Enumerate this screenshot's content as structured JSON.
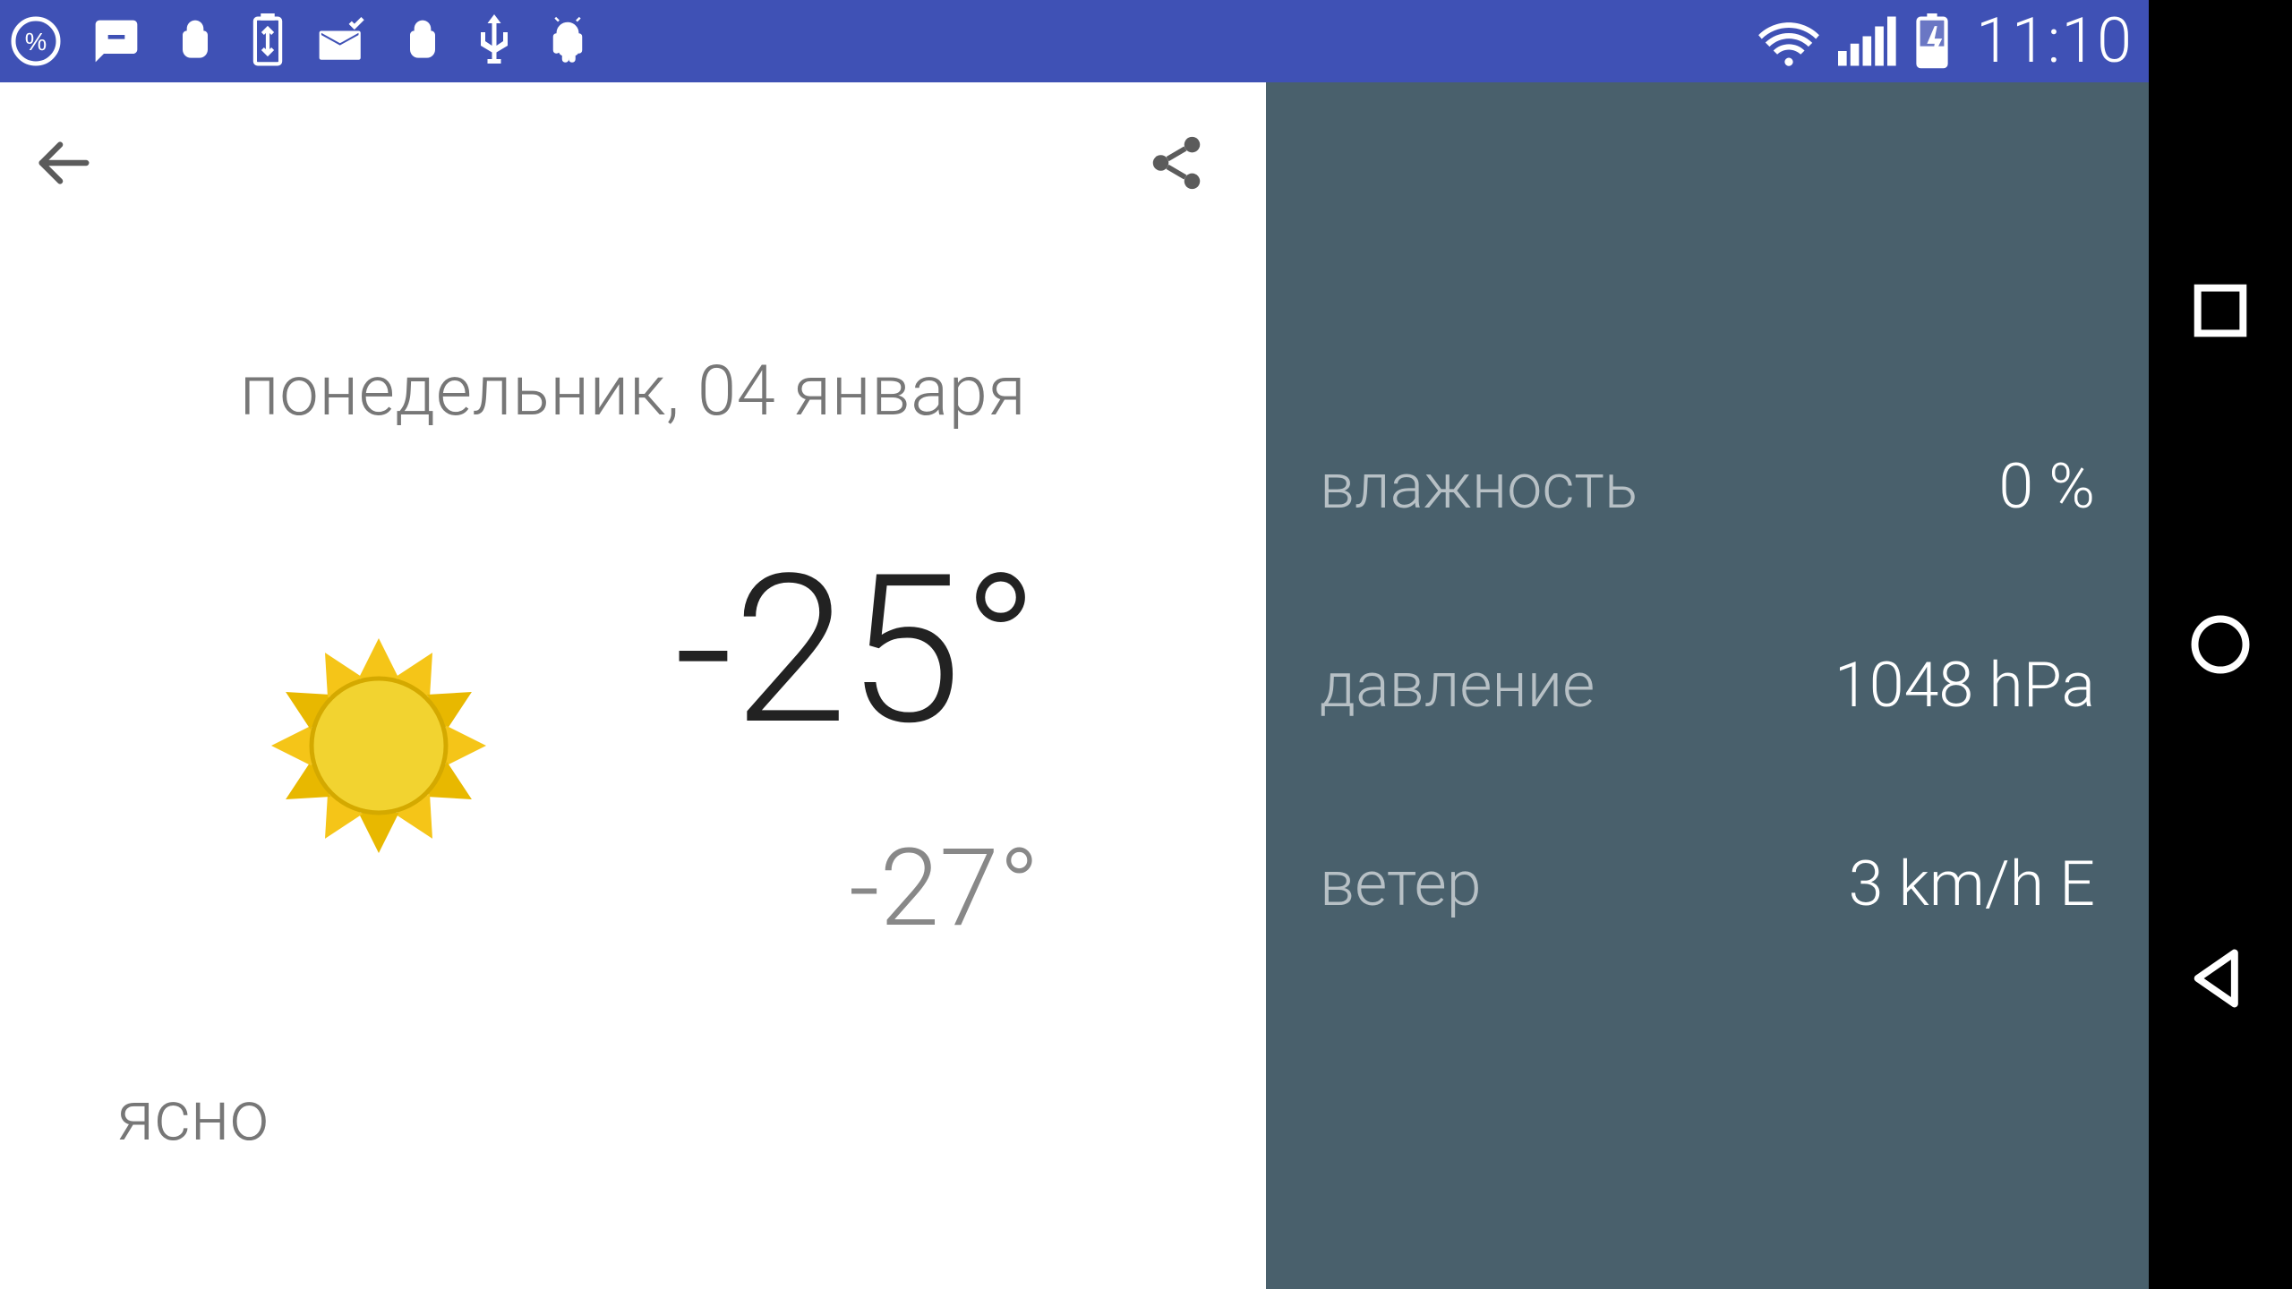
{
  "statusbar": {
    "time": "11:10"
  },
  "weather": {
    "date": "понедельник, 04 января",
    "condition": "ясно",
    "temp_high": "-25°",
    "temp_low": "-27°"
  },
  "details": {
    "humidity_label": "влажность",
    "humidity_value": "0 %",
    "pressure_label": "давление",
    "pressure_value": "1048 hPa",
    "wind_label": "ветер",
    "wind_value": "3 km/h E"
  },
  "colors": {
    "statusbar": "#3f51b5",
    "panel_right": "#49606c"
  }
}
